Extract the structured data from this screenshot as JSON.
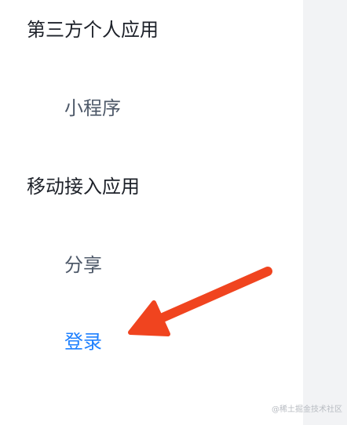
{
  "sidebar": {
    "groups": [
      {
        "title": "第三方个人应用",
        "items": [
          {
            "label": "小程序",
            "active": false
          }
        ]
      },
      {
        "title": "移动接入应用",
        "items": [
          {
            "label": "分享",
            "active": false
          },
          {
            "label": "登录",
            "active": true
          }
        ]
      }
    ]
  },
  "colors": {
    "active": "#1e80ff",
    "heading": "#1d2129",
    "item": "#4e5969",
    "arrow": "#f0441f"
  },
  "watermark": "@稀土掘金技术社区"
}
